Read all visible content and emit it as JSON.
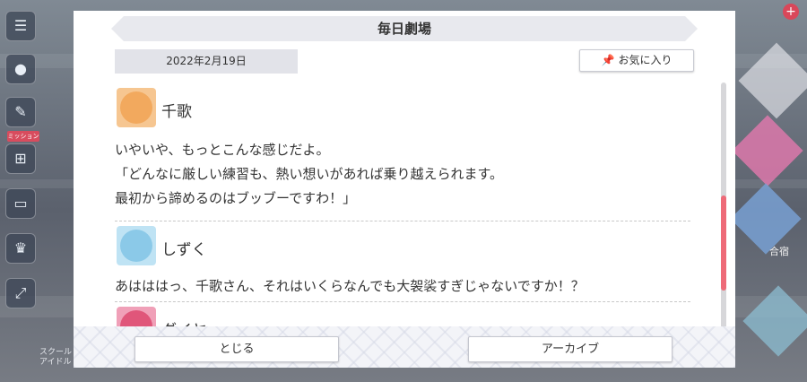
{
  "dialog": {
    "title": "毎日劇場",
    "date": "2022年2月19日",
    "favorite_label": "お気に入り",
    "entries": [
      {
        "speaker": "千歌",
        "lines": [
          "いやいや、もっとこんな感じだよ。",
          "「どんなに厳しい練習も、熱い想いがあれば乗り越えられます。",
          "最初から諦めるのはブッブーですわ！」"
        ],
        "avatar_color": "#f2a95e"
      },
      {
        "speaker": "しずく",
        "lines": [
          "あはははっ、千歌さん、それはいくらなんでも大袈裟すぎじゃないですか！？"
        ],
        "avatar_color": "#8bc9e8"
      },
      {
        "speaker": "ダイヤ",
        "lines": [],
        "avatar_color": "#e0567a"
      }
    ],
    "close_label": "とじる",
    "archive_label": "アーカイブ"
  },
  "background": {
    "side_badge": "ミッション",
    "bottom_left_label": "スクール\nアイドル",
    "right_label": "合宿"
  },
  "colors": {
    "scroll_thumb": "#ee6a78",
    "title_bar": "#e8e9ee",
    "accent_pink": "#d9475a"
  },
  "icons": [
    "menu-icon",
    "chat-icon",
    "gift-icon",
    "photo-icon",
    "trophy-icon",
    "expand-icon",
    "pin-icon",
    "plus-icon"
  ]
}
